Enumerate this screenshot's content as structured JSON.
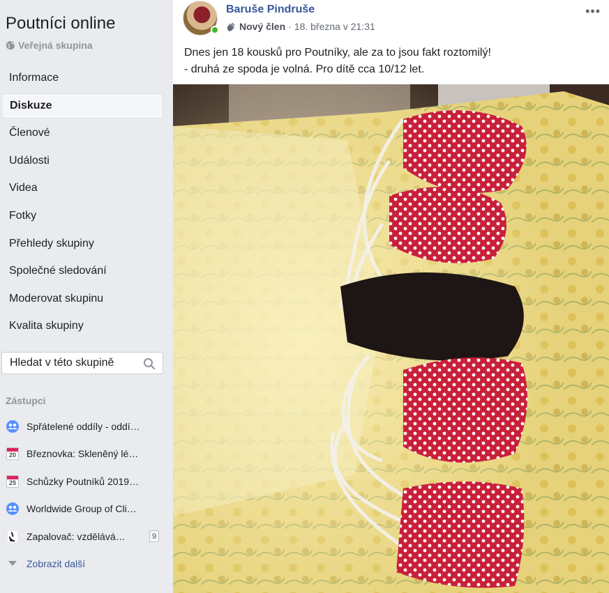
{
  "sidebar": {
    "group_name": "Poutníci online",
    "privacy": "Veřejná skupina",
    "nav": [
      {
        "label": "Informace",
        "active": false
      },
      {
        "label": "Diskuze",
        "active": true
      },
      {
        "label": "Členové",
        "active": false
      },
      {
        "label": "Události",
        "active": false
      },
      {
        "label": "Videa",
        "active": false
      },
      {
        "label": "Fotky",
        "active": false
      },
      {
        "label": "Přehledy skupiny",
        "active": false
      },
      {
        "label": "Společné sledování",
        "active": false
      },
      {
        "label": "Moderovat skupinu",
        "active": false
      },
      {
        "label": "Kvalita skupiny",
        "active": false
      }
    ],
    "search_placeholder": "Hledat v této skupině",
    "shortcuts_heading": "Zástupci",
    "shortcuts": [
      {
        "icon": "group-icon",
        "label": "Spřátelené oddíly - oddí…"
      },
      {
        "icon": "calendar-icon",
        "day": "20",
        "label": "Březnovka: Skleněný lé…"
      },
      {
        "icon": "calendar-icon",
        "day": "25",
        "label": "Schůzky Poutníků 2019…"
      },
      {
        "icon": "group-icon",
        "label": "Worldwide Group of Cli…"
      },
      {
        "icon": "lighter-icon",
        "label": "Zapalovač: vzdělává…",
        "badge": "9"
      }
    ],
    "show_more": "Zobrazit další"
  },
  "post": {
    "author": "Baruše Pindruše",
    "member_badge": "Nový člen",
    "separator": "·",
    "timestamp": "18. března v 21:31",
    "more": "•••",
    "text_line1": "Dnes jen 18 kousků pro Poutníky, ale za to jsou fakt roztomilý!",
    "text_line2": "- druhá ze spoda je volná. Pro dítě cca 10/12 let."
  },
  "colors": {
    "link": "#385898",
    "muted": "#90949c",
    "background": "#e9ebee",
    "online": "#42b72a",
    "mask_red": "#c9203a"
  }
}
